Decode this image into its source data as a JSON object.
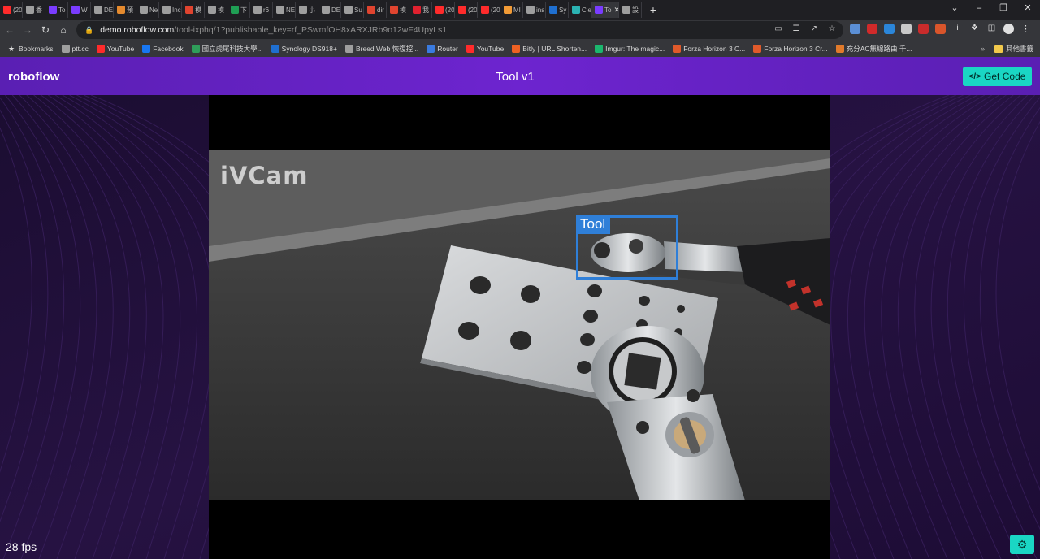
{
  "browser": {
    "tabs": [
      {
        "label": "(20",
        "color": "#ff2b2b"
      },
      {
        "label": "香",
        "color": "#9e9e9e"
      },
      {
        "label": "To",
        "color": "#7a3cff"
      },
      {
        "label": "W",
        "color": "#7a3cff"
      },
      {
        "label": "DE",
        "color": "#9e9e9e"
      },
      {
        "label": "預",
        "color": "#e58a2e"
      },
      {
        "label": "Ne",
        "color": "#9e9e9e"
      },
      {
        "label": "Inc",
        "color": "#9e9e9e"
      },
      {
        "label": "模",
        "color": "#e0442f"
      },
      {
        "label": "模",
        "color": "#9e9e9e"
      },
      {
        "label": "下",
        "color": "#1f9e54"
      },
      {
        "label": "r6",
        "color": "#9e9e9e"
      },
      {
        "label": "NE",
        "color": "#9e9e9e"
      },
      {
        "label": "小",
        "color": "#9e9e9e"
      },
      {
        "label": "DE",
        "color": "#9e9e9e"
      },
      {
        "label": "Su",
        "color": "#9e9e9e"
      },
      {
        "label": "dir",
        "color": "#e0442f"
      },
      {
        "label": "模",
        "color": "#e0442f"
      },
      {
        "label": "我",
        "color": "#e0212f"
      },
      {
        "label": "(20",
        "color": "#ff2b2b"
      },
      {
        "label": "(20",
        "color": "#ff2b2b"
      },
      {
        "label": "(20",
        "color": "#ff2b2b"
      },
      {
        "label": "MI",
        "color": "#f29b36"
      },
      {
        "label": "ins",
        "color": "#9e9e9e"
      },
      {
        "label": "Sy",
        "color": "#1f6fd0"
      },
      {
        "label": "Cle",
        "color": "#2bb3b3"
      },
      {
        "label": "To",
        "color": "#7a3cff",
        "active": true
      },
      {
        "label": "設",
        "color": "#9e9e9e"
      }
    ],
    "new_tab": "+",
    "url_host": "demo.roboflow.com",
    "url_path": "/tool-ixphq/1?publishable_key=rf_PSwmfOH8xARXJRb9o12wF4UpyLs1",
    "bookmarks": [
      {
        "label": "Bookmarks",
        "color": "#dddddd"
      },
      {
        "label": "ptt.cc",
        "color": "#9e9e9e"
      },
      {
        "label": "YouTube",
        "color": "#ff2b2b"
      },
      {
        "label": "Facebook",
        "color": "#1877f2"
      },
      {
        "label": "國立虎尾科技大學...",
        "color": "#2f9e5a"
      },
      {
        "label": "Synology DS918+",
        "color": "#1f6fd0"
      },
      {
        "label": "Breed Web 恢復控...",
        "color": "#9e9e9e"
      },
      {
        "label": "Router",
        "color": "#3a7be0"
      },
      {
        "label": "YouTube",
        "color": "#ff2b2b"
      },
      {
        "label": "Bitly | URL Shorten...",
        "color": "#ee6123"
      },
      {
        "label": "Imgur: The magic...",
        "color": "#1bb76e"
      },
      {
        "label": "Forza Horizon 3 C...",
        "color": "#e05a2b"
      },
      {
        "label": "Forza Horizon 3 Cr...",
        "color": "#e05a2b"
      },
      {
        "label": "充分AC無線路由 千...",
        "color": "#e07a2b"
      }
    ],
    "other_bookmarks": "其他書籤"
  },
  "app": {
    "brand": "roboflow",
    "title": "Tool v1",
    "get_code_icon": "</>",
    "get_code_label": "Get Code",
    "fps_label": "28 fps",
    "settings_icon": "⚙"
  },
  "video": {
    "watermark": "iVCam",
    "detection_label": "Tool"
  },
  "colors": {
    "brand_purple": "#6d24cf",
    "accent_teal": "#1ad6c4",
    "detection_box": "#2f7fd8"
  }
}
